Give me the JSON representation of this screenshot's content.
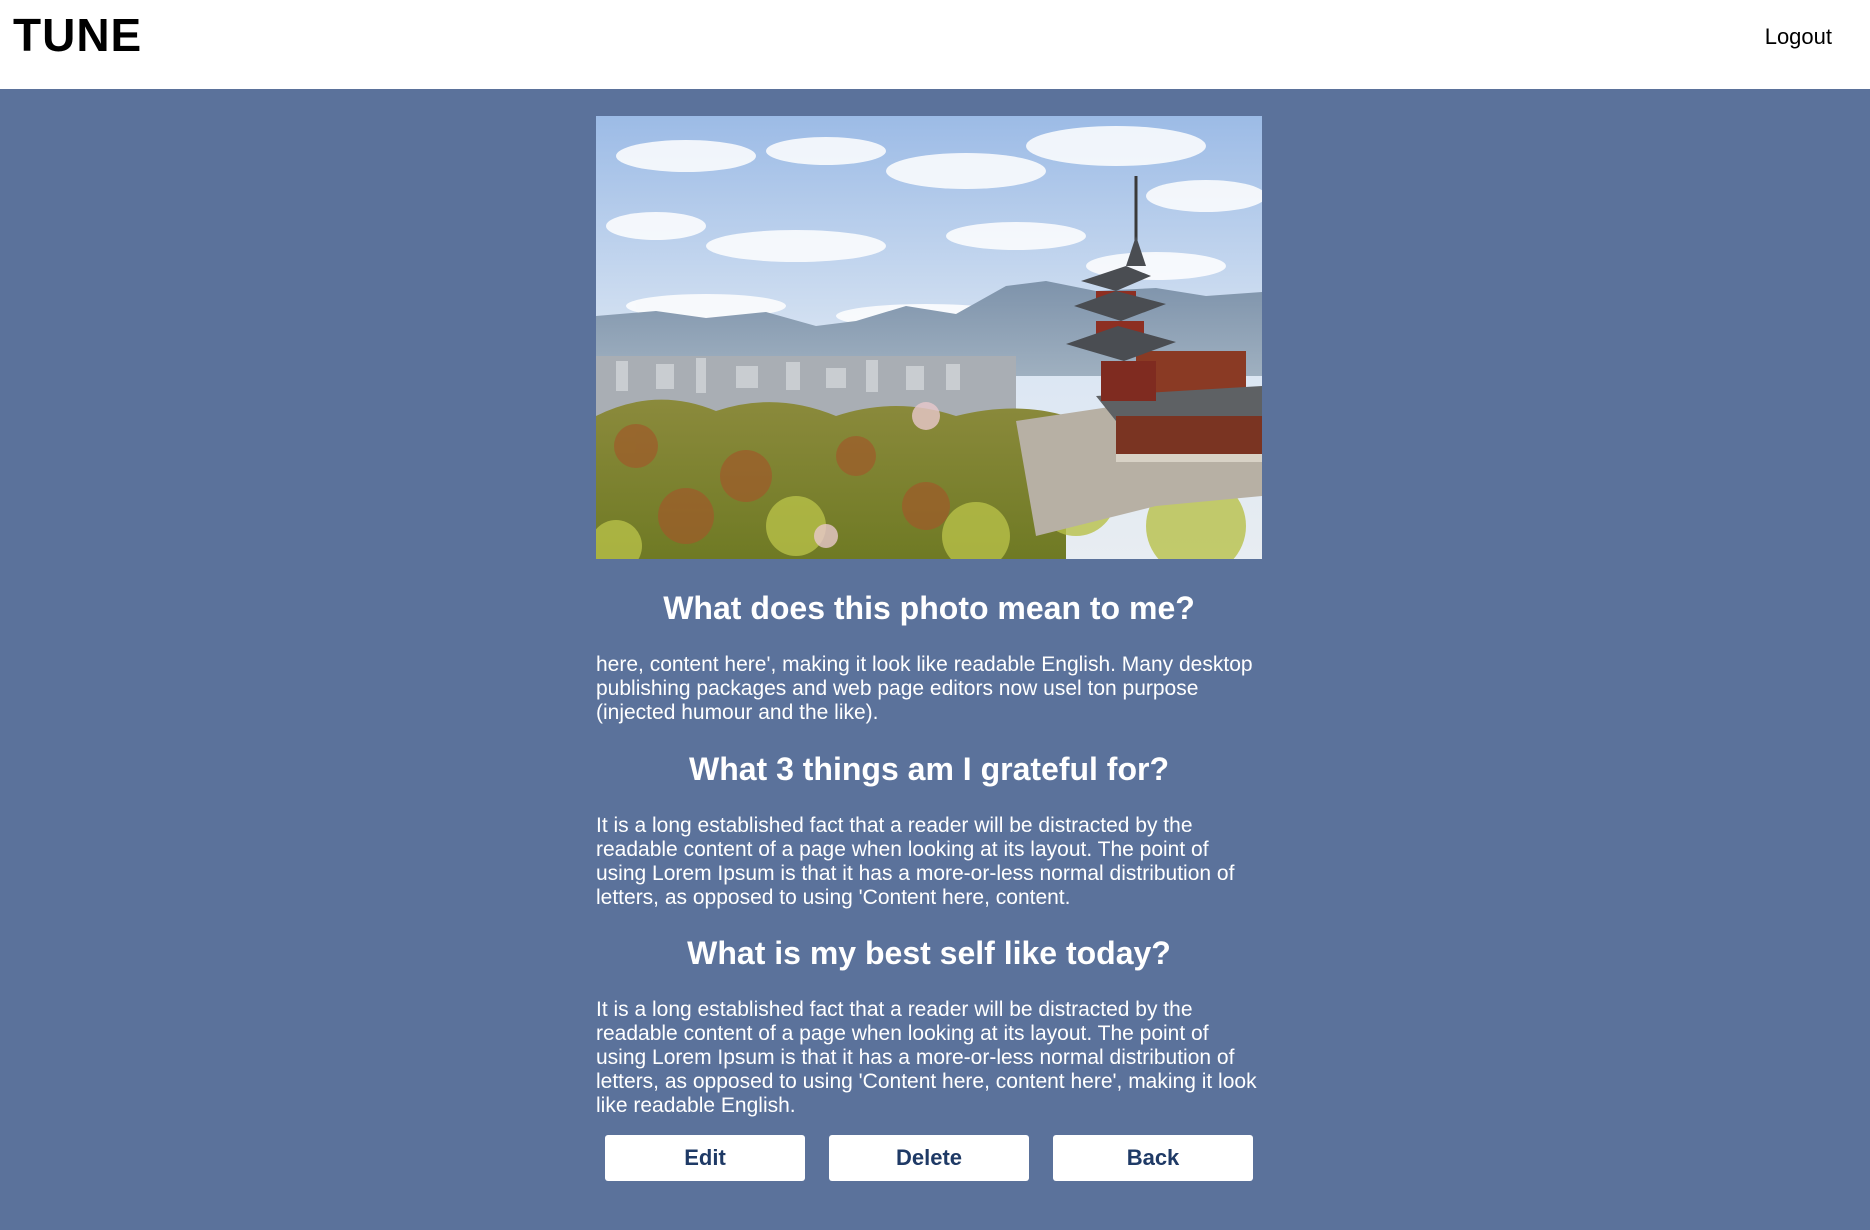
{
  "header": {
    "brand": "TUNE",
    "logout_label": "Logout"
  },
  "entry": {
    "photo_alt": "Pagoda overlooking city and mountains",
    "sections": [
      {
        "question": "What does this photo mean to me?",
        "answer": "here, content here', making it look like readable English. Many desktop publishing packages and web page editors now usel ton purpose (injected humour and the like)."
      },
      {
        "question": "What 3 things am I grateful for?",
        "answer": "It is a long established fact that a reader will be distracted by the readable content of a page when looking at its layout. The point of using Lorem Ipsum is that it has a more-or-less normal distribution of letters, as opposed to using 'Content here, content."
      },
      {
        "question": "What is my best self like today?",
        "answer": "It is a long established fact that a reader will be distracted by the readable content of a page when looking at its layout. The point of using Lorem Ipsum is that it has a more-or-less normal distribution of letters, as opposed to using 'Content here, content here', making it look like readable English."
      }
    ]
  },
  "actions": {
    "edit_label": "Edit",
    "delete_label": "Delete",
    "back_label": "Back"
  },
  "colors": {
    "background": "#5b729b",
    "header_bg": "#ffffff",
    "button_text": "#1f3a66"
  }
}
